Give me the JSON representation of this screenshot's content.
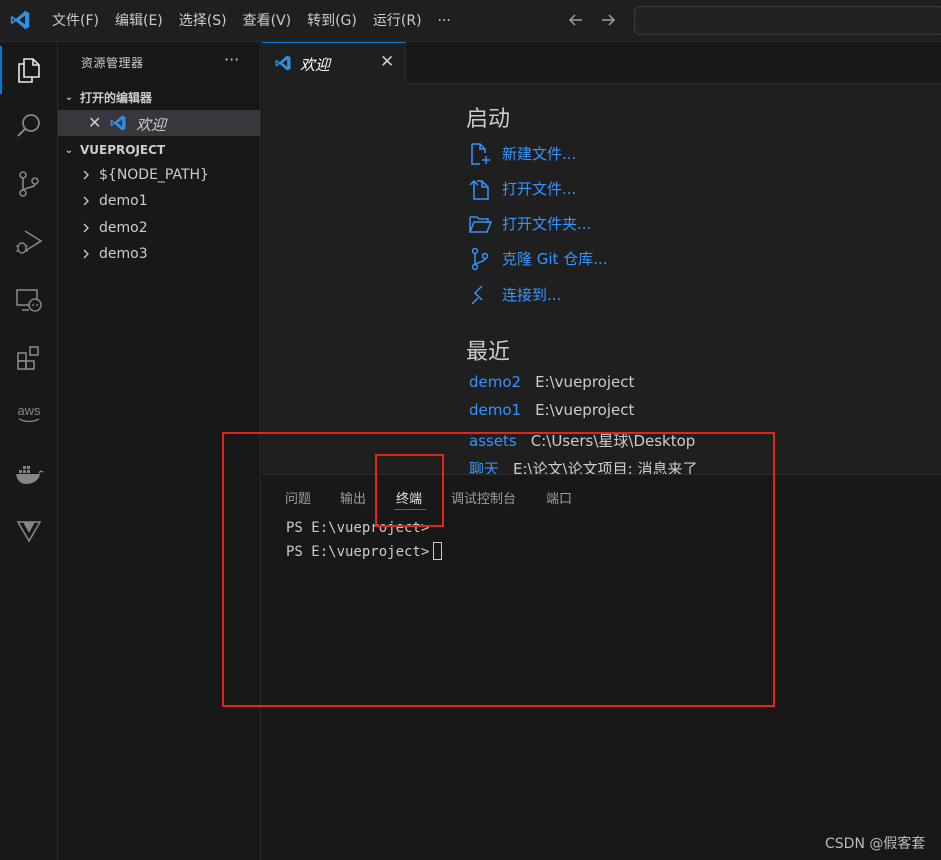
{
  "titlebar": {
    "menu": [
      "文件(F)",
      "编辑(E)",
      "选择(S)",
      "查看(V)",
      "转到(G)",
      "运行(R)",
      "···"
    ]
  },
  "activitybar": {
    "items": [
      "explorer-icon",
      "search-icon",
      "source-control-icon",
      "run-debug-icon",
      "remote-explorer-icon",
      "extensions-icon",
      "aws-icon",
      "docker-icon",
      "vetur-icon"
    ],
    "aws_label": "aws"
  },
  "sidebar": {
    "title": "资源管理器",
    "more": "···",
    "open_editors_title": "打开的编辑器",
    "open_editor_label": "欢迎",
    "project_title": "VUEPROJECT",
    "tree": [
      "${NODE_PATH}",
      "demo1",
      "demo2",
      "demo3"
    ]
  },
  "editor": {
    "tab_label": "欢迎",
    "start_heading": "启动",
    "start_items": [
      "新建文件...",
      "打开文件...",
      "打开文件夹...",
      "克隆 Git 仓库...",
      "连接到..."
    ],
    "recent_heading": "最近",
    "recent": [
      {
        "name": "demo2",
        "path": "E:\\vueproject"
      },
      {
        "name": "demo1",
        "path": "E:\\vueproject"
      },
      {
        "name": "assets",
        "path": "C:\\Users\\星球\\Desktop"
      },
      {
        "name": "聊天",
        "path": "E:\\论文\\论文项目: 消息来了"
      }
    ]
  },
  "panel": {
    "tabs": [
      "问题",
      "输出",
      "终端",
      "调试控制台",
      "端口"
    ],
    "active_tab": "终端",
    "terminal_lines": [
      "PS E:\\vueproject>",
      "PS E:\\vueproject>"
    ]
  },
  "watermark": "CSDN @假客套",
  "colors": {
    "accent": "#0078d4",
    "link": "#3794ff",
    "annotation_red": "#e0261d"
  }
}
